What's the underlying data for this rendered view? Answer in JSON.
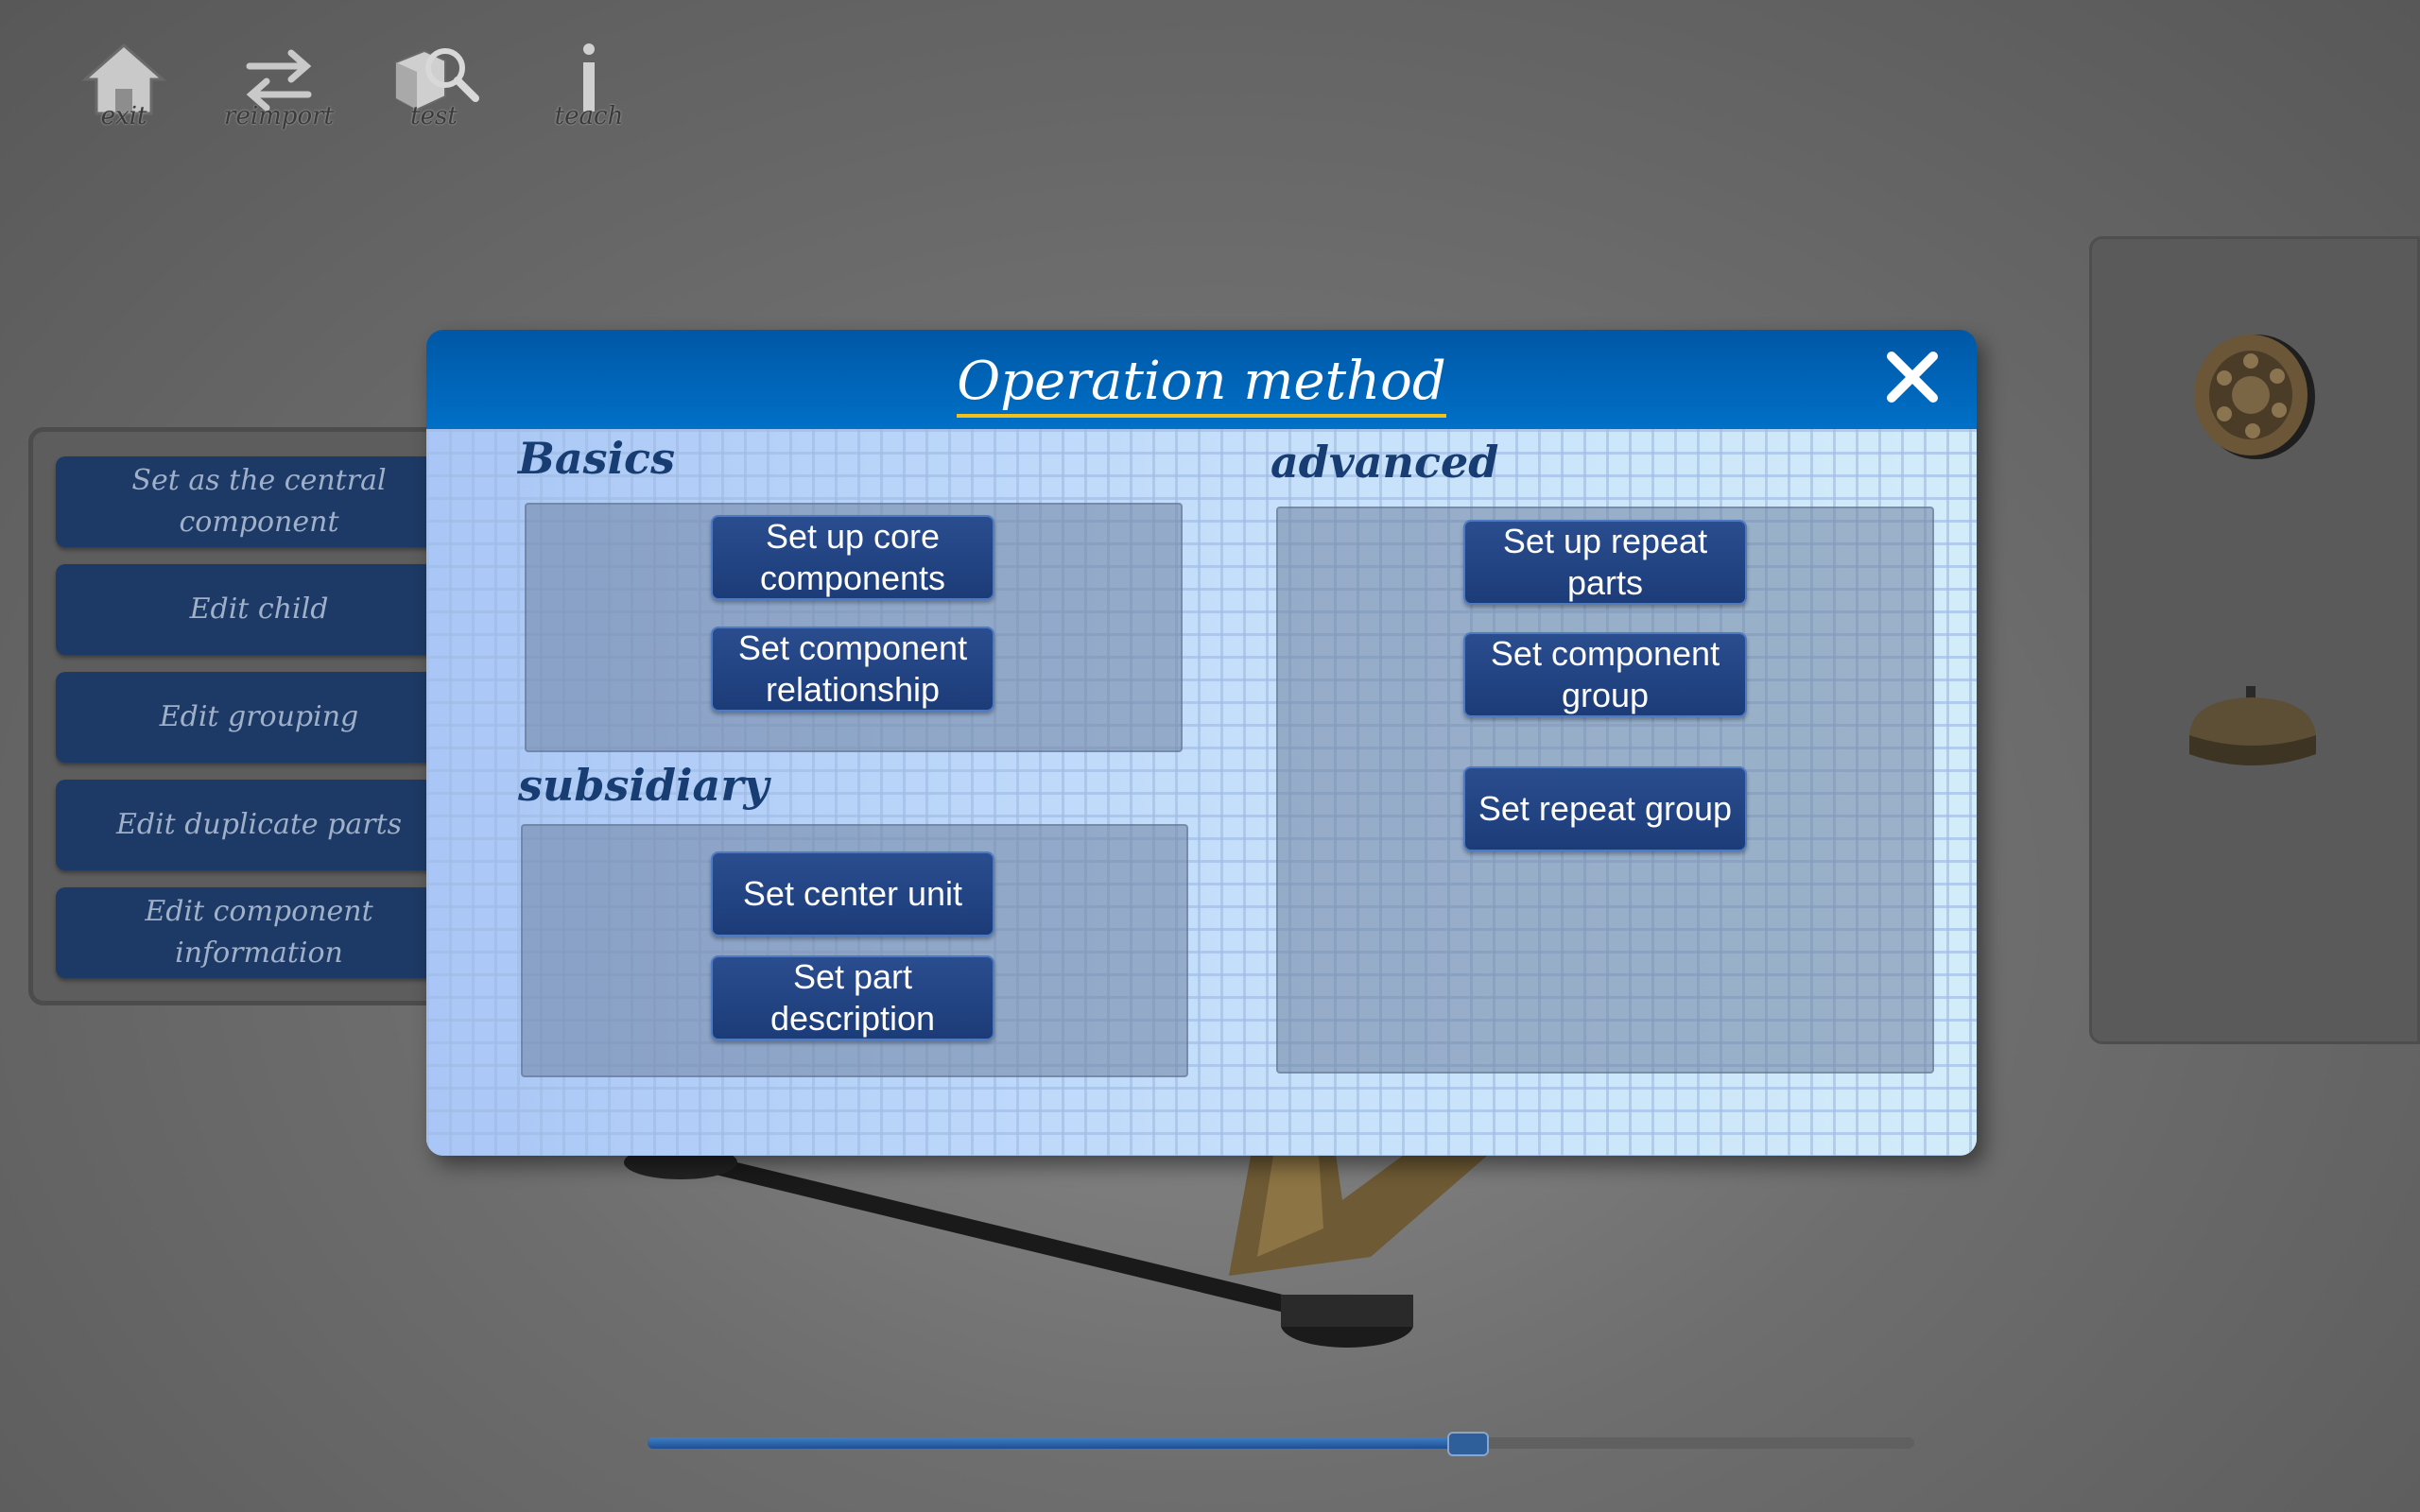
{
  "toolbar": {
    "items": [
      {
        "label": "exit",
        "icon": "home-icon"
      },
      {
        "label": "reimport",
        "icon": "swap-arrows-icon"
      },
      {
        "label": "test",
        "icon": "box-magnifier-icon"
      },
      {
        "label": "teach",
        "icon": "info-icon"
      }
    ]
  },
  "side_menu": {
    "items": [
      {
        "label": "Set as the central component"
      },
      {
        "label": "Edit child"
      },
      {
        "label": "Edit grouping"
      },
      {
        "label": "Edit duplicate parts"
      },
      {
        "label": "Edit component information"
      }
    ]
  },
  "right_panel": {
    "thumbnails": [
      {
        "icon": "dial-part-icon"
      },
      {
        "icon": "dome-part-icon"
      }
    ]
  },
  "dialog": {
    "title": "Operation method",
    "close_icon": "close-icon",
    "basics": {
      "title": "Basics",
      "buttons": [
        {
          "label": "Set up core components"
        },
        {
          "label": "Set component relationship"
        }
      ]
    },
    "subsidiary": {
      "title": "subsidiary",
      "buttons": [
        {
          "label": "Set center unit"
        },
        {
          "label": "Set part description"
        }
      ]
    },
    "advanced": {
      "title": "advanced",
      "buttons": [
        {
          "label": "Set up repeat parts"
        },
        {
          "label": "Set component group"
        },
        {
          "label": "Set repeat group"
        }
      ]
    }
  },
  "slider": {
    "value_fraction": 0.648
  },
  "colors": {
    "header_blue": "#0063b5",
    "button_navy": "#1d3a66",
    "title_underline": "#f3c21a"
  }
}
